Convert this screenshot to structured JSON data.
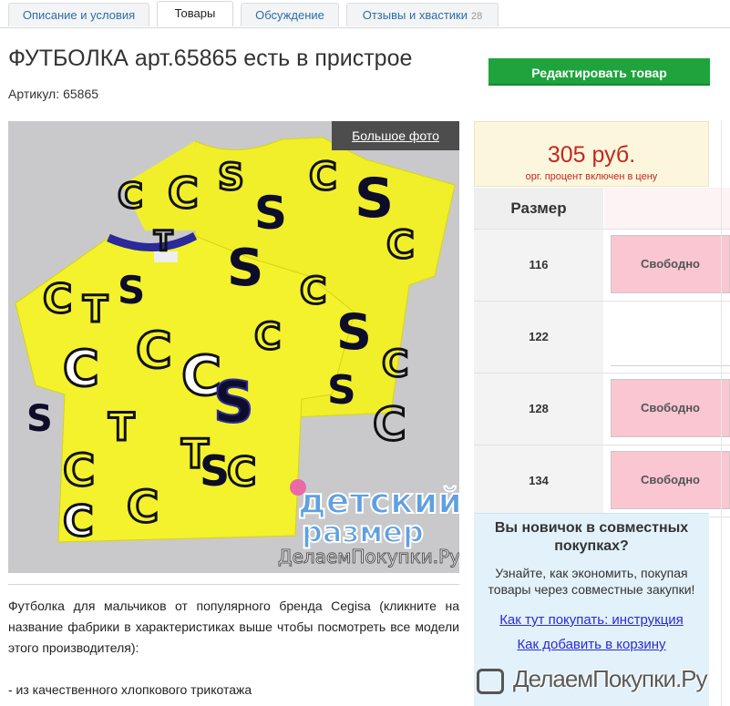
{
  "tabs": [
    {
      "label": "Описание и условия"
    },
    {
      "label": "Товары"
    },
    {
      "label": "Обсуждение"
    },
    {
      "label": "Отзывы и хвастики",
      "count": "28"
    }
  ],
  "product": {
    "title": "ФУТБОЛКА арт.65865 есть в пристрое",
    "article_label": "Артикул:",
    "article_value": "65865",
    "edit_button": "Редактировать товар",
    "big_photo_label": "Большое фото",
    "photo_watermark_line1": "детский",
    "photo_watermark_line2": "размер",
    "photo_watermark_site": "ДелаемПокупки.Ру",
    "garment_color": "#f0ef2a"
  },
  "price": {
    "value": "305 руб.",
    "note": "орг. процент включен в цену"
  },
  "sizes": {
    "header": "Размер",
    "rows": [
      {
        "size": "116",
        "status": "Свободно"
      },
      {
        "size": "122",
        "status": ""
      },
      {
        "size": "128",
        "status": "Свободно"
      },
      {
        "size": "134",
        "status": "Свободно"
      }
    ]
  },
  "description": {
    "paragraph": "Футболка для мальчиков от популярного бренда Cegisa (кликните на название фабрики в характеристиках выше чтобы посмотреть все модели этого производителя):",
    "bullet": "- из качественного хлопкового трикотажа"
  },
  "newbie": {
    "title": "Вы новичок в совместных покупках?",
    "text": "Узнайте, как экономить, покупая товары через совместные закупки!",
    "link1": "Как тут покупать: инструкция",
    "link2": "Как добавить в корзину"
  },
  "watermark": {
    "text": "ДелаемПокупки.Ру"
  }
}
